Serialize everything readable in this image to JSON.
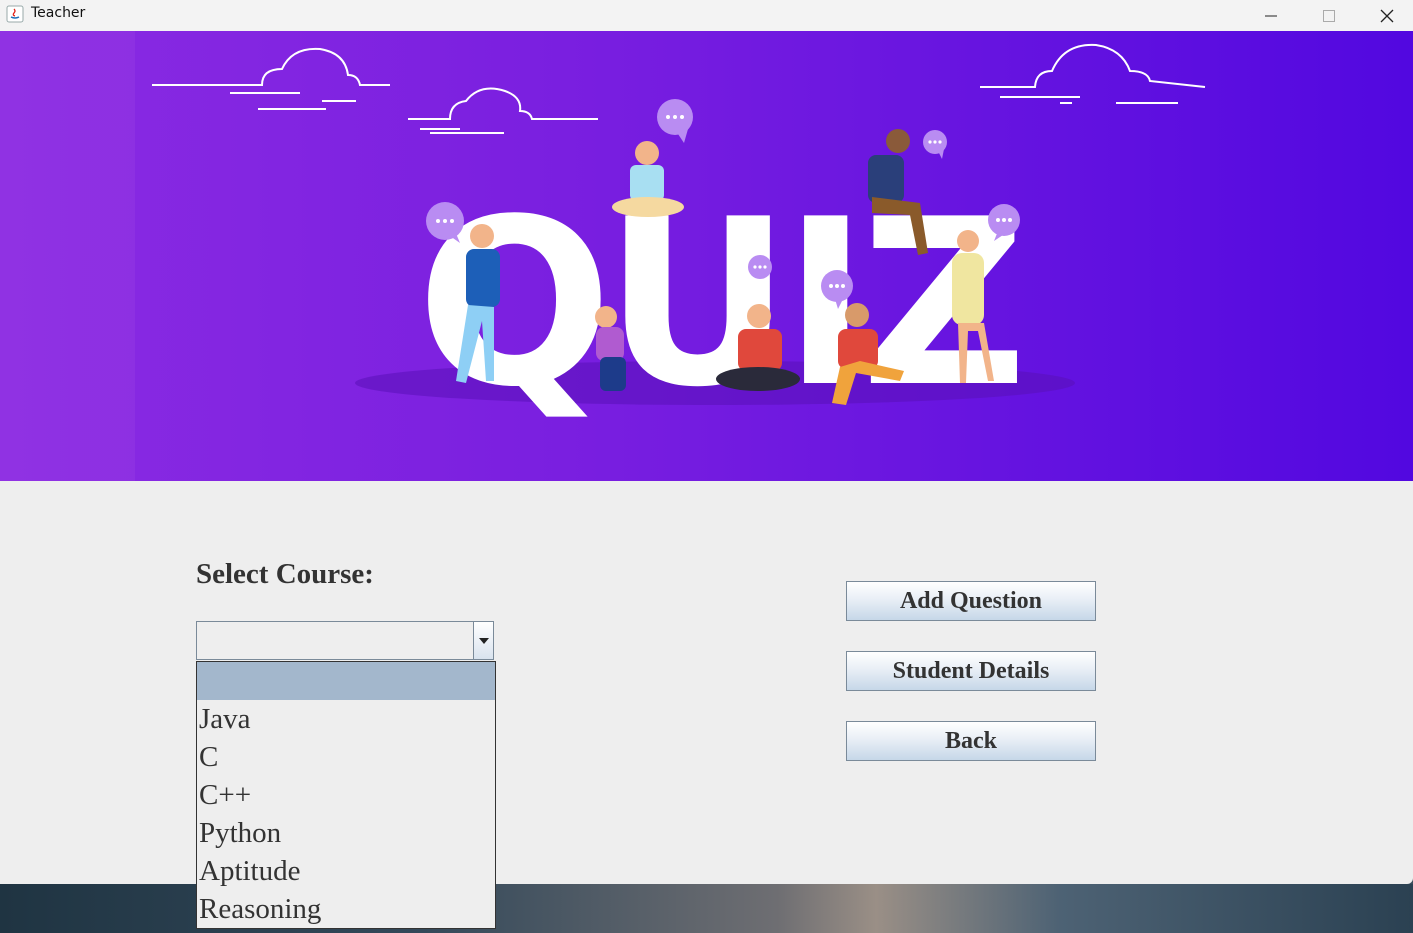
{
  "window": {
    "title": "Teacher"
  },
  "banner": {
    "title_word": "QUIZ"
  },
  "form": {
    "course_label": "Select Course:",
    "selected_value": "",
    "options": [
      "",
      "Java",
      "C",
      "C++",
      "Python",
      "Aptitude",
      "Reasoning"
    ]
  },
  "buttons": {
    "add_question": "Add Question",
    "student_details": "Student Details",
    "back": "Back"
  },
  "colors": {
    "banner_start": "#8a2be2",
    "banner_end": "#5208e0",
    "selection": "#a3b7cc",
    "window_bg": "#eeeeee"
  }
}
